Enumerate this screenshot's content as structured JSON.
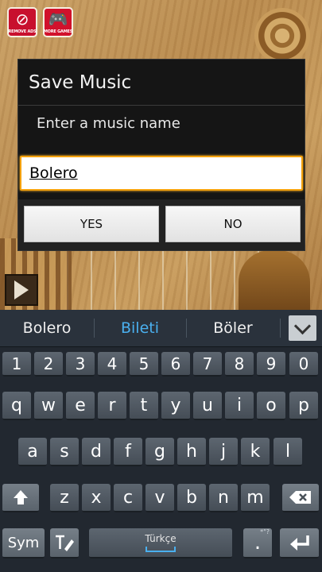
{
  "game": {
    "remove_ads": {
      "icon": "no-entry-icon",
      "label": "REMOVE ADS"
    },
    "more_games": {
      "icon": "gamepad-icon",
      "label": "MORE GAMES"
    },
    "play": {
      "icon": "play-icon"
    }
  },
  "dialog": {
    "title": "Save Music",
    "message": "Enter a music name",
    "input_value": "Bolero",
    "yes_label": "YES",
    "no_label": "NO",
    "accent": "#f5a20c"
  },
  "keyboard": {
    "suggestions": [
      "Bolero",
      "Bileti",
      "Böler"
    ],
    "suggestion_highlight_color": "#4ab0ef",
    "number_row": [
      "1",
      "2",
      "3",
      "4",
      "5",
      "6",
      "7",
      "8",
      "9",
      "0"
    ],
    "row1": [
      "q",
      "w",
      "e",
      "r",
      "t",
      "y",
      "u",
      "i",
      "o",
      "p"
    ],
    "row2": [
      "a",
      "s",
      "d",
      "f",
      "g",
      "h",
      "j",
      "k",
      "l"
    ],
    "row3": [
      "z",
      "x",
      "c",
      "v",
      "b",
      "n",
      "m"
    ],
    "sym_label": "Sym",
    "space_label": "Türkçe",
    "period_label": ".",
    "period_hint": "*\"?"
  }
}
